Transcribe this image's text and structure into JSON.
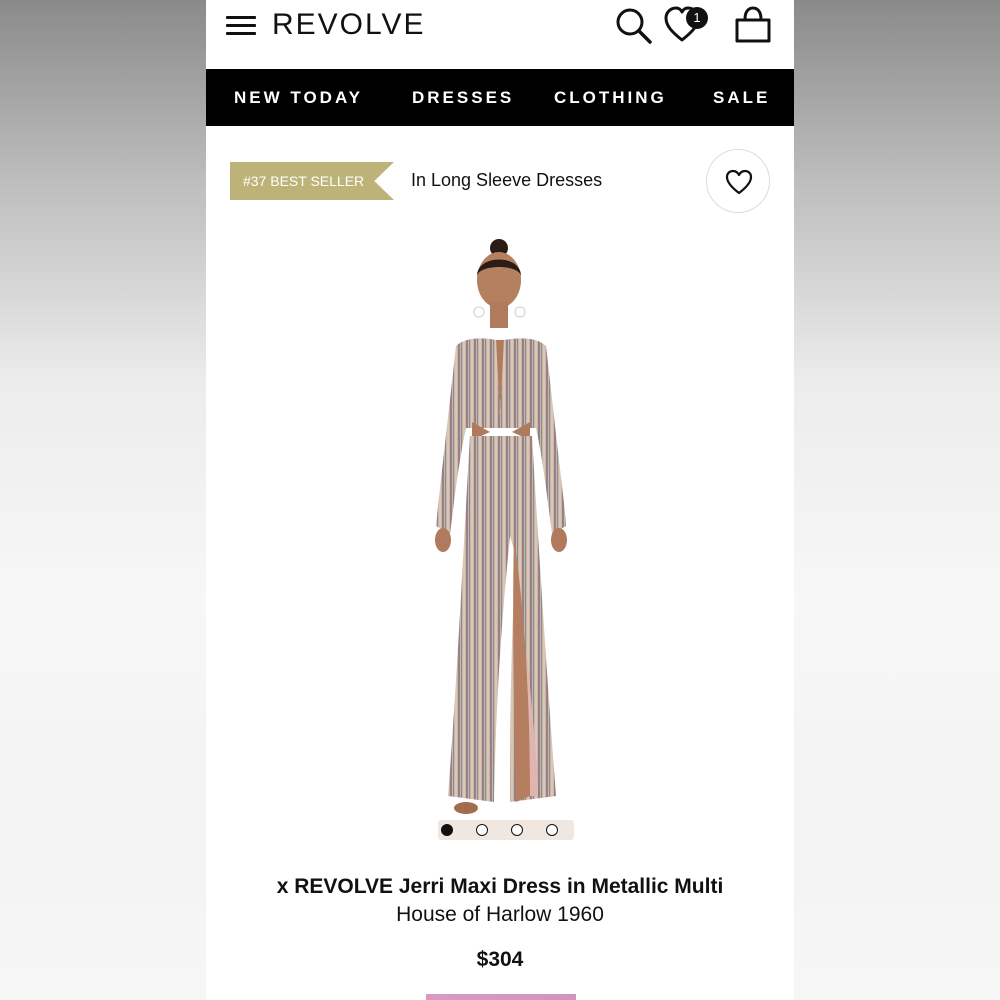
{
  "header": {
    "logo": "REVOLVE",
    "wishlist_count": "1",
    "icons": [
      "hamburger-menu-icon",
      "search-icon",
      "heart-icon",
      "shopping-bag-icon"
    ]
  },
  "nav": {
    "items": [
      "NEW TODAY",
      "DRESSES",
      "CLOTHING",
      "SALE"
    ]
  },
  "bestseller": {
    "badge": "#37 BEST SELLER",
    "context": "In Long Sleeve Dresses",
    "badge_color": "#bdb378"
  },
  "gallery": {
    "image_count": 4,
    "active_index": 0
  },
  "product": {
    "title": "x REVOLVE Jerri Maxi Dress in Metallic Multi",
    "brand": "House of Harlow 1960",
    "price": "$304"
  },
  "colors": {
    "nav_bg": "#000000",
    "accent": "#bdb378"
  }
}
